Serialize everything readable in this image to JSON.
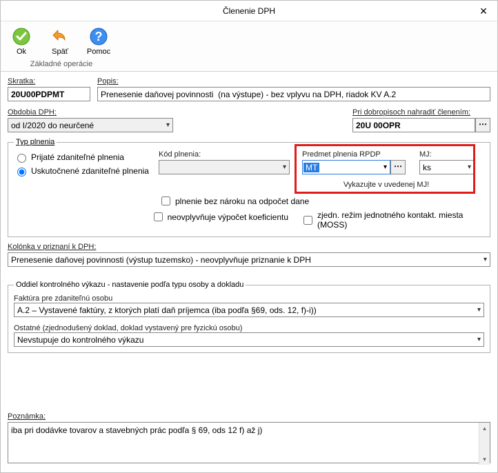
{
  "title": "Členenie DPH",
  "ribbon": {
    "group_label": "Základné operácie",
    "ok": "Ok",
    "back": "Späť",
    "help": "Pomoc"
  },
  "skratka": {
    "label": "Skratka:",
    "value": "20U00PDPMT"
  },
  "popis": {
    "label": "Popis:",
    "value": "Prenesenie daňovej povinnosti  (na výstupe) - bez vplyvu na DPH, riadok KV A.2"
  },
  "obdobia": {
    "label": "Obdobia DPH:",
    "value": "od I/2020 do neurčené"
  },
  "dobropis": {
    "label": "Pri dobropisoch nahradiť členením:",
    "value": "20U 00OPR"
  },
  "typ_plnenia": {
    "legend": "Typ plnenia",
    "r1": "Prijaté zdaniteľné plnenia",
    "r2": "Uskutočnené zdaniteľné plnenia",
    "kod_label": "Kód plnenia:",
    "kod_value": "",
    "chk1": "plnenie bez nároku na odpočet dane",
    "chk2": "neovplyvňuje výpočet koeficientu",
    "chk3": "zjedn. režim jednotného kontakt. miesta (MOSS)",
    "predmet_label": "Predmet plnenia RPDP",
    "predmet_value": "MT",
    "mj_label": "MJ:",
    "mj_value": "ks",
    "hint": "Vykazujte v uvedenej MJ!"
  },
  "kolonka": {
    "label": "Kolónka v priznaní k DPH:",
    "value": "Prenesenie daňovej povinnosti (výstup tuzemsko) - neovplyvňuje priznanie k DPH"
  },
  "kv": {
    "legend": "Oddiel kontrolného výkazu - nastavenie podľa typu osoby a dokladu",
    "lbl1": "Faktúra pre zdaniteľnú osobu",
    "val1": "A.2 – Vystavené faktúry, z ktorých platí daň príjemca (iba podľa §69, ods. 12, f)-i))",
    "lbl2": "Ostatné (zjednodušený doklad, doklad vystavený pre fyzickú osobu)",
    "val2": "Nevstupuje do kontrolného výkazu"
  },
  "poznamka": {
    "label": "Poznámka:",
    "value": "iba pri dodávke tovarov a stavebných prác podľa § 69, ods 12 f) až j)"
  }
}
